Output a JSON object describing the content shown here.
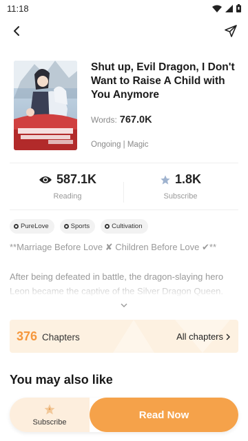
{
  "status_bar": {
    "time": "11:18"
  },
  "book": {
    "title": "Shut up, Evil Dragon, I Don't Want to Raise A Child with You Anymore",
    "words_label": "Words:",
    "words_value": "767.0K",
    "status_genre": "Ongoing | Magic"
  },
  "stats": {
    "reading_value": "587.1K",
    "reading_label": "Reading",
    "subscribe_value": "1.8K",
    "subscribe_label": "Subscribe"
  },
  "tags": [
    "PureLove",
    "Sports",
    "Cultivation"
  ],
  "subtitle": "**Marriage Before Love ✘  Children Before Love ✔**",
  "synopsis": "After being defeated in battle, the dragon-slaying hero Leon became the captive of the Silver Dragon Queen.",
  "chapters": {
    "count": "376",
    "label": "Chapters",
    "all_label": "All chapters"
  },
  "recommend": {
    "title": "You may also like"
  },
  "actions": {
    "subscribe_label": "Subscribe",
    "read_label": "Read Now"
  },
  "colors": {
    "accent": "#f5a24a",
    "accent_light": "#fdeedd",
    "chapters_bg": "#fdf1e1"
  }
}
